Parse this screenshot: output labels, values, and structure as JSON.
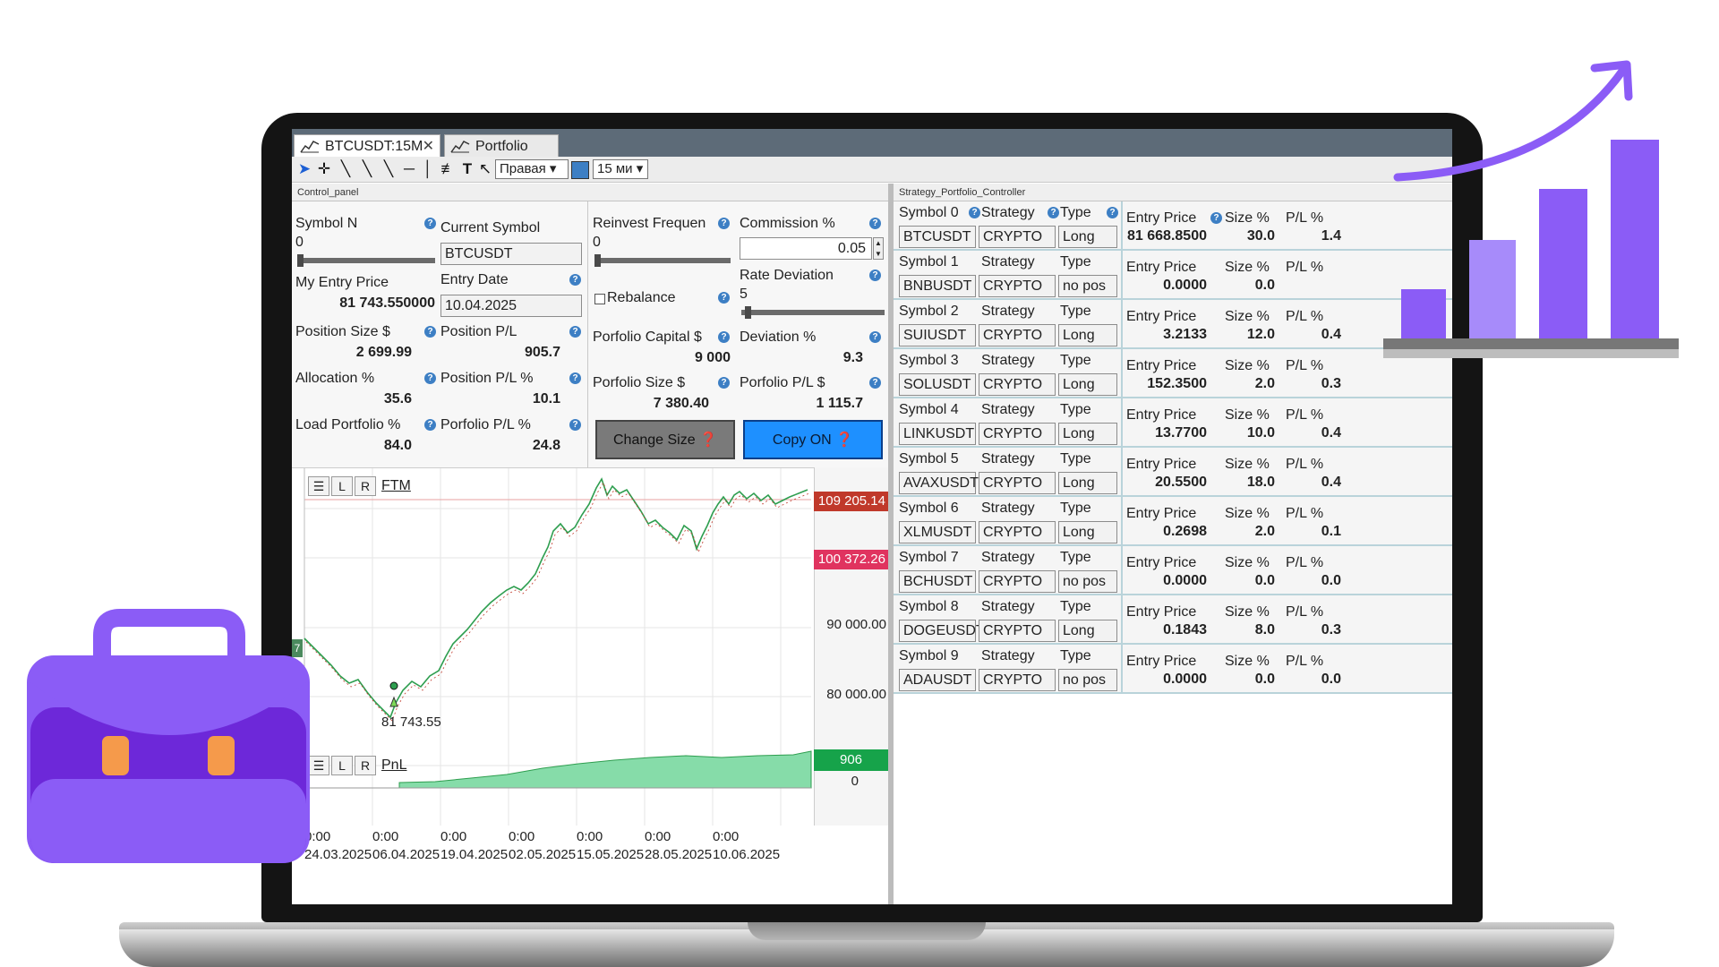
{
  "tabs": [
    {
      "label": "BTCUSDT:15M",
      "close": "✕"
    },
    {
      "label": "Portfolio"
    }
  ],
  "toolbar": {
    "align_select": "Правая",
    "timeframe_select": "15 ми"
  },
  "control_panel": {
    "title": "Control_panel",
    "symbol_n": {
      "label": "Symbol N",
      "value": "0"
    },
    "current_symbol": {
      "label": "Current Symbol",
      "value": "BTCUSDT"
    },
    "my_entry_price": {
      "label": "My Entry Price",
      "value": "81 743.550000"
    },
    "entry_date": {
      "label": "Entry Date",
      "value": "10.04.2025"
    },
    "position_size": {
      "label": "Position  Size $",
      "value": "2 699.99"
    },
    "position_pl": {
      "label": "Position P/L",
      "value": "905.7"
    },
    "allocation": {
      "label": "Allocation %",
      "value": "35.6"
    },
    "position_pl_pct": {
      "label": "Position P/L %",
      "value": "10.1"
    },
    "load_portfolio": {
      "label": "Load Portfolio %",
      "value": "84.0"
    },
    "porfolio_pl_pct": {
      "label": "Porfolio P/L %",
      "value": "24.8"
    },
    "reinvest": {
      "label": "Reinvest Frequen",
      "value": "0"
    },
    "commission": {
      "label": "Commission %",
      "value": "0.05"
    },
    "rate_deviation": {
      "label": "Rate Deviation",
      "value": "5"
    },
    "rebalance": {
      "label": "Rebalance"
    },
    "porfolio_capital": {
      "label": "Porfolio Capital $",
      "value": "9 000"
    },
    "deviation": {
      "label": "Deviation %",
      "value": "9.3"
    },
    "porfolio_size": {
      "label": "Porfolio Size $",
      "value": "7 380.40"
    },
    "porfolio_pl": {
      "label": "Porfolio P/L $",
      "value": "1 115.7"
    },
    "change_size_button": "Change Size",
    "copy_button": "Copy ON"
  },
  "chart": {
    "symbol": "FTM",
    "pnl_label": "PnL",
    "l_button": "L",
    "r_button": "R",
    "price_tags": {
      "high": "109 205.14",
      "current": "100 372.26"
    },
    "axis_prices": [
      "90 000.00",
      "80 000.00"
    ],
    "entry_annotation": "81 743.55",
    "pnl_tag": "906",
    "pnl_zero": "0",
    "left_edge_tag": "7",
    "x_labels": [
      {
        "time": "0:00",
        "date": "24.03.2025"
      },
      {
        "time": "0:00",
        "date": "06.04.2025"
      },
      {
        "time": "0:00",
        "date": "19.04.2025"
      },
      {
        "time": "0:00",
        "date": "02.05.2025"
      },
      {
        "time": "0:00",
        "date": "15.05.2025"
      },
      {
        "time": "0:00",
        "date": "28.05.2025"
      },
      {
        "time": "0:00",
        "date": "10.06.2025"
      }
    ]
  },
  "strategy": {
    "title": "Strategy_Portfolio_Controller",
    "col_labels": {
      "strategy": "Strategy",
      "type": "Type",
      "entry_price": "Entry Price",
      "size": "Size %",
      "pl": "P/L %"
    },
    "rows": [
      {
        "label": "Symbol 0",
        "symbol": "BTCUSDT",
        "strategy": "CRYPTO",
        "type": "Long",
        "entry": "81 668.8500",
        "size": "30.0",
        "pl": "1.4"
      },
      {
        "label": "Symbol 1",
        "symbol": "BNBUSDT",
        "strategy": "CRYPTO",
        "type": "no pos",
        "entry": "0.0000",
        "size": "0.0",
        "pl": ""
      },
      {
        "label": "Symbol 2",
        "symbol": "SUIUSDT",
        "strategy": "CRYPTO",
        "type": "Long",
        "entry": "3.2133",
        "size": "12.0",
        "pl": "0.4"
      },
      {
        "label": "Symbol 3",
        "symbol": "SOLUSDT",
        "strategy": "CRYPTO",
        "type": "Long",
        "entry": "152.3500",
        "size": "2.0",
        "pl": "0.3"
      },
      {
        "label": "Symbol 4",
        "symbol": "LINKUSDT",
        "strategy": "CRYPTO",
        "type": "Long",
        "entry": "13.7700",
        "size": "10.0",
        "pl": "0.4"
      },
      {
        "label": "Symbol 5",
        "symbol": "AVAXUSDT",
        "strategy": "CRYPTO",
        "type": "Long",
        "entry": "20.5500",
        "size": "18.0",
        "pl": "0.4"
      },
      {
        "label": "Symbol 6",
        "symbol": "XLMUSDT",
        "strategy": "CRYPTO",
        "type": "Long",
        "entry": "0.2698",
        "size": "2.0",
        "pl": "0.1"
      },
      {
        "label": "Symbol 7",
        "symbol": "BCHUSDT",
        "strategy": "CRYPTO",
        "type": "no pos",
        "entry": "0.0000",
        "size": "0.0",
        "pl": "0.0"
      },
      {
        "label": "Symbol 8",
        "symbol": "DOGEUSDT",
        "strategy": "CRYPTO",
        "type": "Long",
        "entry": "0.1843",
        "size": "8.0",
        "pl": "0.3"
      },
      {
        "label": "Symbol 9",
        "symbol": "ADAUSDT",
        "strategy": "CRYPTO",
        "type": "no pos",
        "entry": "0.0000",
        "size": "0.0",
        "pl": "0.0"
      }
    ]
  },
  "colors": {
    "accent_purple": "#8b5cf6",
    "copy_button": "#1e90ff",
    "down_tag": "#c0392b",
    "current_tag": "#e0335f",
    "pnl_green": "#16a34a"
  },
  "decor_icons": [
    "briefcase-icon",
    "growth-bar-chart-icon"
  ]
}
